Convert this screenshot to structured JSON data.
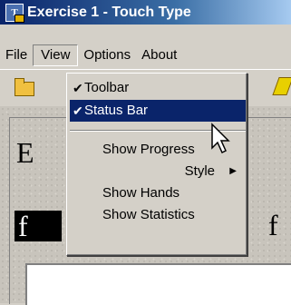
{
  "window": {
    "title": "Exercise 1 - Touch Type"
  },
  "menubar": {
    "items": [
      "File",
      "View",
      "Options",
      "About"
    ]
  },
  "view_menu": {
    "items": [
      {
        "label": "Toolbar",
        "checked": true
      },
      {
        "label": "Status Bar",
        "checked": true,
        "selected": true
      },
      {
        "label": "Show Progress",
        "checked": false
      },
      {
        "label": "Style",
        "checked": false,
        "submenu": true
      },
      {
        "label": "Show Hands",
        "checked": false
      },
      {
        "label": "Show Statistics",
        "checked": false
      }
    ]
  },
  "content": {
    "heading_letter": "E",
    "highlight_letter": "f",
    "right_letter": "f"
  },
  "colors": {
    "selection": "#0a246a",
    "face": "#d4d0c8"
  }
}
